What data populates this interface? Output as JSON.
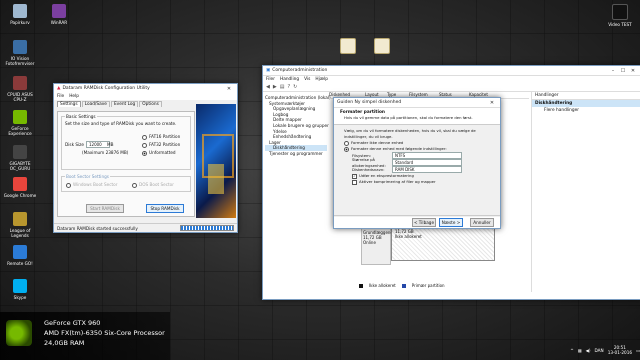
{
  "desktop": {
    "left_icons": [
      {
        "label": "Papirkurv",
        "color": "#9fb8d0"
      },
      {
        "label": "IO Vision Fotofremviser",
        "color": "#3a6ea5"
      },
      {
        "label": "CPUID ASUS CPU-Z",
        "color": "#8a3a3a"
      },
      {
        "label": "GeForce Experience",
        "color": "#76b900"
      },
      {
        "label": "GIGABYTE OC_GURU",
        "color": "#444"
      },
      {
        "label": "Google Chrome",
        "color": "#e8453c"
      },
      {
        "label": "League of Legends",
        "color": "#b8962e"
      },
      {
        "label": "Remote GO!",
        "color": "#2b7bd6"
      },
      {
        "label": "Skype",
        "color": "#00aff0"
      }
    ],
    "winrar_icon": {
      "label": "WinRAR",
      "color": "#7b3fa0"
    },
    "video_icon": {
      "label": "Video TEST",
      "color": "#222"
    },
    "mid_icons": [
      {
        "label": "",
        "color": "#e8e0c0"
      },
      {
        "label": "",
        "color": "#e8e0c0"
      }
    ]
  },
  "sysinfo": {
    "gpu": "GeForce GTX 960",
    "cpu": "AMD FX(tm)-6350 Six-Core Processor",
    "ram": "24,0GB RAM"
  },
  "ramdisk": {
    "title": "Dataram RAMDisk Configuration Utility",
    "menu": [
      "File",
      "Help"
    ],
    "tabs": [
      "Settings",
      "Load/Save",
      "Event Log",
      "Options"
    ],
    "basic_settings_title": "Basic Settings",
    "basic_settings_desc": "Set the size and type of RAMDisk you want to create.",
    "disk_size_label": "Disk Size",
    "disk_size_value": "12000",
    "disk_size_unit": "MB",
    "maximum": "(Maximum 23876 MB)",
    "fs_options": [
      "FAT16 Partition",
      "FAT32 Partition",
      "Unformatted"
    ],
    "fs_selected": 2,
    "boot_title": "Boot Sector Settings",
    "boot_options": [
      "Windows Boot Sector",
      "DOS Boot Sector"
    ],
    "start_button": "Start RAMDisk",
    "stop_button": "Stop RAMDisk",
    "status": "Dataram RAMDisk started successfully"
  },
  "compmgmt": {
    "title": "Computeradministration",
    "menu": [
      "Filer",
      "Handling",
      "Vis",
      "Hjælp"
    ],
    "tree": [
      "Computeradministration (lokal)",
      "Systemværktøjer",
      "Opgaveplanlægning",
      "Logbog",
      "Delte mapper",
      "Lokale brugere og grupper",
      "Ydelse",
      "Enhedshåndtering",
      "Lager",
      "Diskhåndtering",
      "Tjenester og programmer"
    ],
    "columns": [
      "Diskenhed",
      "Layout",
      "Type",
      "Filsystem",
      "Status",
      "Kapacitet"
    ],
    "disk_label": "Disk 3",
    "disk_info": [
      "Grundlæggende",
      "11,72 GB",
      "Online"
    ],
    "partition_size": "11,72 GB",
    "partition_status": "Ikke allokeret",
    "legend": [
      "Ikke allokeret",
      "Primær partition"
    ],
    "actions_title": "Handlinger",
    "actions": [
      "Diskhåndtering",
      "Flere handlinger"
    ]
  },
  "wizard": {
    "title": "Guiden Ny simpel diskenhed",
    "heading": "Formater partition",
    "subheading": "Hvis du vil gemme data på partitionen, skal du formatere den først.",
    "intro": "Vælg, om du vil formatere diskenheden, hvis du vil, skal du vælge de indstillinger, du vil bruge.",
    "option_no_format": "Formater ikke denne enhed",
    "option_format": "Formater denne enhed med følgende indstillinger:",
    "fs_label": "Filsystem:",
    "fs_value": "NTFS",
    "alloc_label": "Størrelse på allokeringsenhed:",
    "alloc_value": "Standard",
    "volume_label": "Diskenhedsnavn:",
    "volume_value": "RAM DISK",
    "quick_format": "Udfør en eksprestormatering",
    "compression": "Aktiver komprimering af filer og mapper",
    "back_button": "< Tilbage",
    "next_button": "Næste >",
    "cancel_button": "Annuller"
  },
  "taskbar": {
    "time": "20:51",
    "date": "13-01-2016",
    "lang": "DAN"
  }
}
